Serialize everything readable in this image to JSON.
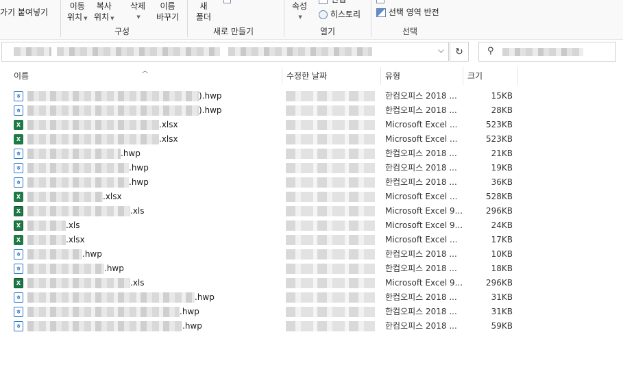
{
  "ribbon": {
    "paste_label": "가기 붙여넣기",
    "move_to": [
      "이동",
      "위치"
    ],
    "copy_to": [
      "복사",
      "위치"
    ],
    "delete_label": "삭제",
    "rename": [
      "이름",
      "바꾸기"
    ],
    "new_folder": [
      "새",
      "폴더"
    ],
    "properties_label": "속성",
    "edit_label": "편집",
    "history_label": "히스토리",
    "invert_selection_label": "선택 영역 반전",
    "groups": {
      "organize": "구성",
      "new": "새로 만들기",
      "open": "열기",
      "select": "선택"
    }
  },
  "columns": {
    "name": "이름",
    "modified": "수정한 날짜",
    "type": "유형",
    "size": "크기"
  },
  "files": [
    {
      "name": ").hwp",
      "kind": "hwp",
      "type": "한컴오피스 2018 ...",
      "size": "15KB",
      "blur": 250
    },
    {
      "name": ").hwp",
      "kind": "hwp",
      "type": "한컴오피스 2018 ...",
      "size": "28KB",
      "blur": 250
    },
    {
      "name": ".xlsx",
      "kind": "xlsx",
      "type": "Microsoft Excel ...",
      "size": "523KB",
      "blur": 192
    },
    {
      "name": ".xlsx",
      "kind": "xlsx",
      "type": "Microsoft Excel ...",
      "size": "523KB",
      "blur": 192
    },
    {
      "name": ".hwp",
      "kind": "hwp",
      "type": "한컴오피스 2018 ...",
      "size": "21KB",
      "blur": 136
    },
    {
      "name": ".hwp",
      "kind": "hwp",
      "type": "한컴오피스 2018 ...",
      "size": "19KB",
      "blur": 148
    },
    {
      "name": ".hwp",
      "kind": "hwp",
      "type": "한컴오피스 2018 ...",
      "size": "36KB",
      "blur": 148
    },
    {
      "name": ".xlsx",
      "kind": "xlsx",
      "type": "Microsoft Excel ...",
      "size": "528KB",
      "blur": 110
    },
    {
      "name": ".xls",
      "kind": "xls",
      "type": "Microsoft Excel 9...",
      "size": "296KB",
      "blur": 150
    },
    {
      "name": ".xls",
      "kind": "xls",
      "type": "Microsoft Excel 9...",
      "size": "24KB",
      "blur": 56
    },
    {
      "name": ".xlsx",
      "kind": "xlsx",
      "type": "Microsoft Excel ...",
      "size": "17KB",
      "blur": 56
    },
    {
      "name": ".hwp",
      "kind": "hwp",
      "type": "한컴오피스 2018 ...",
      "size": "10KB",
      "blur": 80
    },
    {
      "name": ".hwp",
      "kind": "hwp",
      "type": "한컴오피스 2018 ...",
      "size": "18KB",
      "blur": 112
    },
    {
      "name": ".xls",
      "kind": "xls",
      "type": "Microsoft Excel 9...",
      "size": "296KB",
      "blur": 150
    },
    {
      "name": ".hwp",
      "kind": "hwp",
      "type": "한컴오피스 2018 ...",
      "size": "31KB",
      "blur": 244
    },
    {
      "name": ".hwp",
      "kind": "hwp",
      "type": "한컴오피스 2018 ...",
      "size": "31KB",
      "blur": 222
    },
    {
      "name": ".hwp",
      "kind": "hwp",
      "type": "한컴오피스 2018 ...",
      "size": "59KB",
      "blur": 226
    }
  ],
  "colors": {
    "hwp_icon": "#2b77c7",
    "excel_icon": "#1d7a45"
  }
}
